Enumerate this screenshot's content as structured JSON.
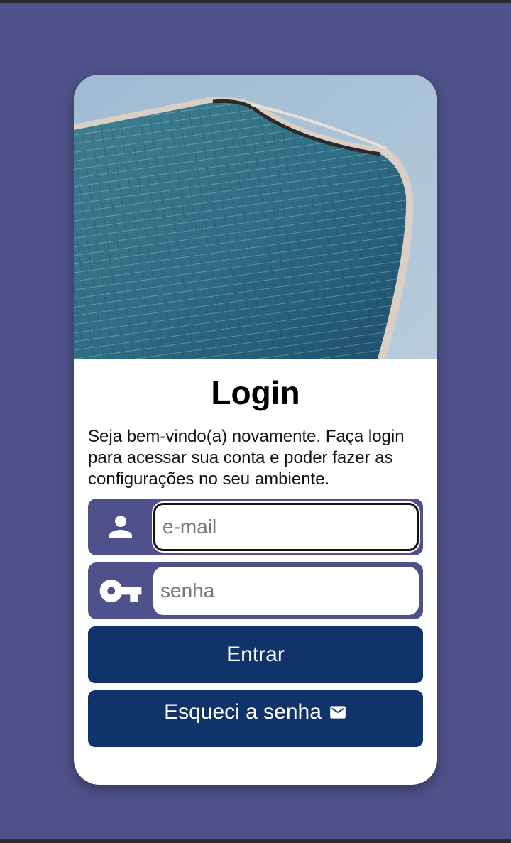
{
  "login": {
    "title": "Login",
    "description": "Seja bem-vindo(a) novamente. Faça login para acessar sua conta e poder fazer as configurações no seu ambiente.",
    "hero_image": "glass skyscraper against blue sky",
    "email": {
      "placeholder": "e-mail",
      "value": "",
      "icon": "person-icon"
    },
    "password": {
      "placeholder": "senha",
      "value": "",
      "icon": "key-icon"
    },
    "enter_button": "Entrar",
    "forgot_button": {
      "label": "Esqueci a senha",
      "icon": "mail-icon"
    }
  },
  "colors": {
    "page_background": "#4f528a",
    "card_background": "#ffffff",
    "input_group": "#4f528a",
    "button": "#10336a",
    "button_text": "#ffffff"
  }
}
